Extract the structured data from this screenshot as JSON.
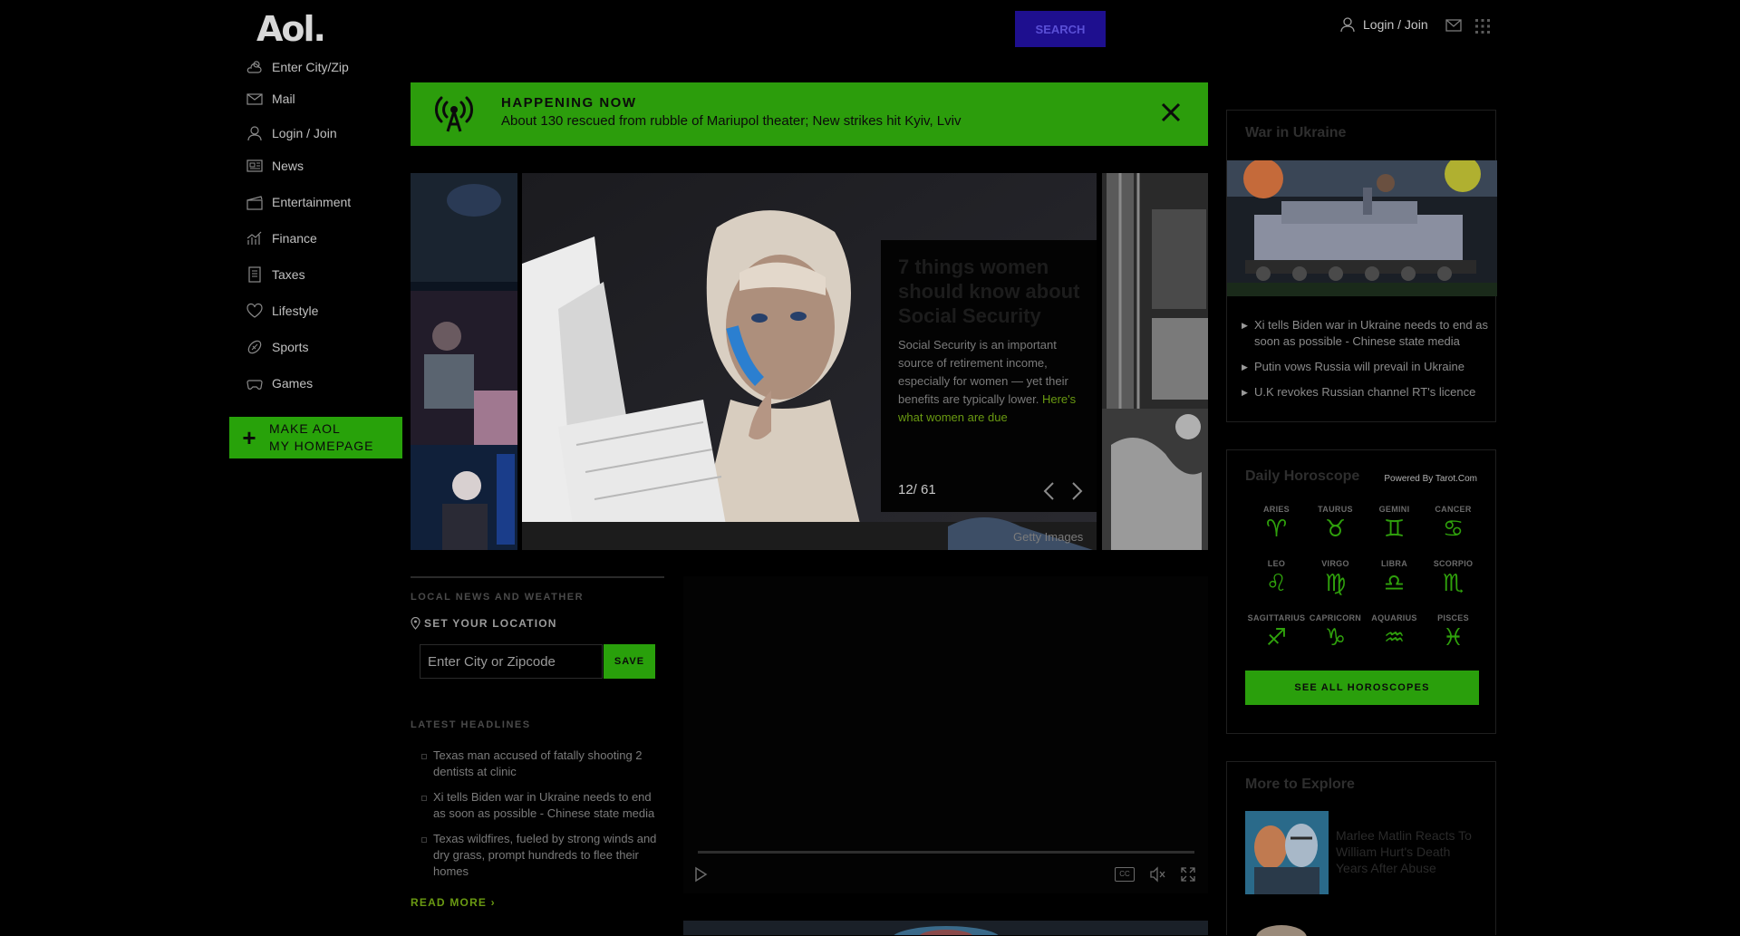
{
  "header": {
    "logo": "Aol.",
    "search_label": "SEARCH",
    "login_label": "Login / Join",
    "icons": [
      "user-icon",
      "mail-icon",
      "apps-grid-icon"
    ]
  },
  "sidebar": {
    "items": [
      {
        "label": "Enter City/Zip",
        "icon": "weather-icon"
      },
      {
        "label": "Mail",
        "icon": "mail-icon"
      },
      {
        "label": "Login / Join",
        "icon": "user-icon"
      },
      {
        "label": "News",
        "icon": "news-icon"
      },
      {
        "label": "Entertainment",
        "icon": "clapper-icon"
      },
      {
        "label": "Finance",
        "icon": "chart-icon"
      },
      {
        "label": "Taxes",
        "icon": "taxes-icon"
      },
      {
        "label": "Lifestyle",
        "icon": "heart-icon"
      },
      {
        "label": "Sports",
        "icon": "football-icon"
      },
      {
        "label": "Games",
        "icon": "gamepad-icon"
      }
    ],
    "make_aol_line1": "MAKE AOL",
    "make_aol_line2": "MY HOMEPAGE"
  },
  "banner": {
    "title": "HAPPENING NOW",
    "text": "About 130 rescued from rubble of Mariupol theater; New strikes hit Kyiv, Lviv"
  },
  "carousel": {
    "title": "7 things women should know about Social Security",
    "description": "Social Security is an important source of retirement income, especially for women — yet their benefits are typically lower.",
    "link": "Here's what women are due",
    "counter": "12/ 61",
    "credit": "Getty Images"
  },
  "local": {
    "section_label": "LOCAL NEWS AND WEATHER",
    "set_location": "SET YOUR LOCATION",
    "zip_placeholder": "Enter City or Zipcode",
    "save_label": "SAVE",
    "headlines_label": "LATEST HEADLINES",
    "headlines": [
      "Texas man accused of fatally shooting 2 dentists at clinic",
      "Xi tells Biden war in Ukraine needs to end as soon as possible - Chinese state media",
      "Texas wildfires, fueled by strong winds and dry grass, prompt hundreds to flee their homes"
    ],
    "read_more": "READ MORE ›"
  },
  "video": {
    "cc_label": "CC"
  },
  "ukraine": {
    "title": "War in Ukraine",
    "items": [
      "Xi tells Biden war in Ukraine needs to end as soon as possible - Chinese state media",
      "Putin vows Russia will prevail in Ukraine",
      "U.K revokes Russian channel RT's licence"
    ]
  },
  "horoscope": {
    "title": "Daily Horoscope",
    "powered_by": "Powered By Tarot.Com",
    "signs": [
      {
        "name": "ARIES",
        "glyph": "♈︎"
      },
      {
        "name": "TAURUS",
        "glyph": "♉︎"
      },
      {
        "name": "GEMINI",
        "glyph": "♊︎"
      },
      {
        "name": "CANCER",
        "glyph": "♋︎"
      },
      {
        "name": "LEO",
        "glyph": "♌︎"
      },
      {
        "name": "VIRGO",
        "glyph": "♍︎"
      },
      {
        "name": "LIBRA",
        "glyph": "♎︎"
      },
      {
        "name": "SCORPIO",
        "glyph": "♏︎"
      },
      {
        "name": "SAGITTARIUS",
        "glyph": "♐︎"
      },
      {
        "name": "CAPRICORN",
        "glyph": "♑︎"
      },
      {
        "name": "AQUARIUS",
        "glyph": "♒︎"
      },
      {
        "name": "PISCES",
        "glyph": "♓︎"
      }
    ],
    "see_all": "SEE ALL HOROSCOPES"
  },
  "explore": {
    "title": "More to Explore",
    "item_text": "Marlee Matlin Reacts To William Hurt's Death Years After Abuse"
  },
  "colors": {
    "brand_green": "#2c9d0c",
    "search_blue": "#1e0f8f",
    "background": "#000000"
  }
}
